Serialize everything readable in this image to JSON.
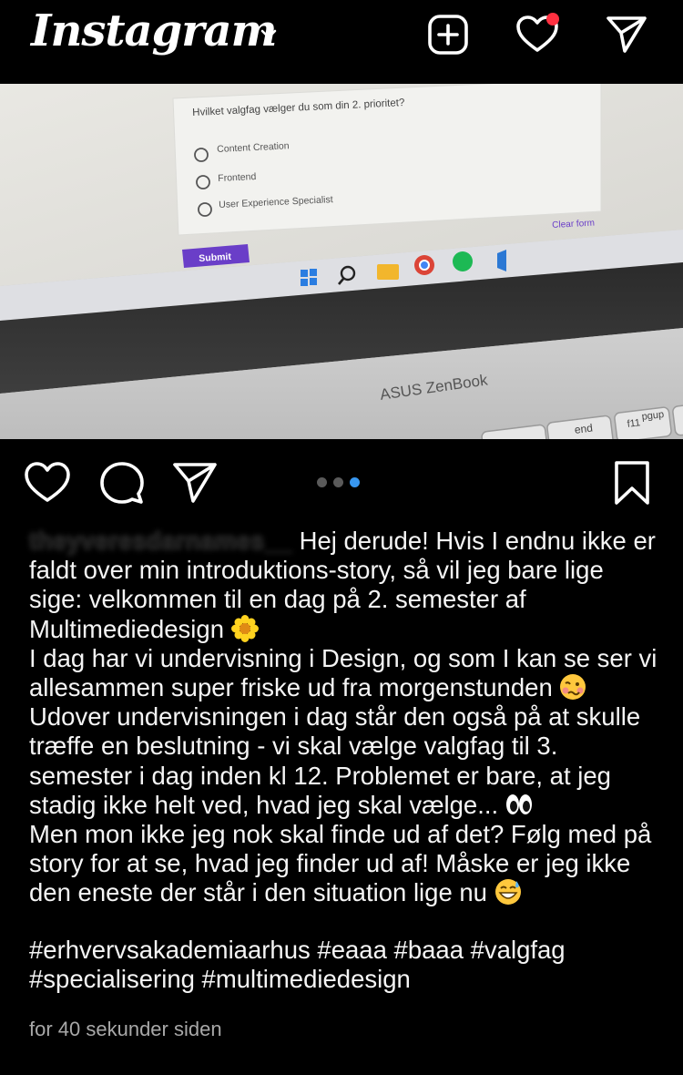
{
  "app": {
    "logo_text": "Instagram",
    "icons": [
      "chevron-down-icon",
      "add-post-icon",
      "activity-heart-icon",
      "direct-message-icon"
    ]
  },
  "photo": {
    "form_question": "Hvilket valgfag vælger du som din 2. prioritet?",
    "options": [
      "Content Creation",
      "Frontend",
      "User Experience Specialist"
    ],
    "clear_label": "Clear form",
    "submit_label": "Submit",
    "laptop_brand": "ASUS ZenBook",
    "keys": [
      "end",
      "f11",
      "pgup"
    ]
  },
  "post_actions": {
    "icons": [
      "like-heart-icon",
      "comment-icon",
      "share-icon",
      "save-bookmark-icon"
    ],
    "carousel_total": 3,
    "carousel_active": 3
  },
  "caption": {
    "username": "theyveresdarnames__",
    "text_1": "Hej derude! Hvis I endnu ikke er faldt over min introduktions-story, så vil jeg bare lige sige: velkommen til en dag på 2. semester af Multimediedesign",
    "text_2": "I dag har vi undervisning i Design, og som I kan se ser vi allesammen super friske ud fra morgenstunden",
    "text_3": "Udover undervisningen i dag står den også på at skulle træffe en beslutning - vi skal vælge valgfag til 3. semester i dag inden kl 12. Problemet er bare, at jeg stadig ikke helt ved, hvad jeg skal vælge...",
    "text_4": "Men mon ikke jeg nok skal finde ud af det? Følg med på story for at se, hvad jeg finder ud af! Måske er jeg ikke den eneste der står i den situation lige nu",
    "emojis": [
      "blossom-emoji",
      "woozy-face-emoji",
      "eyes-emoji",
      "grinning-sweat-emoji"
    ],
    "hashtags": "#erhvervsakademiaarhus #eaaa #baaa #valgfag #specialisering #multimediedesign",
    "timestamp": "for 40 sekunder siden"
  }
}
